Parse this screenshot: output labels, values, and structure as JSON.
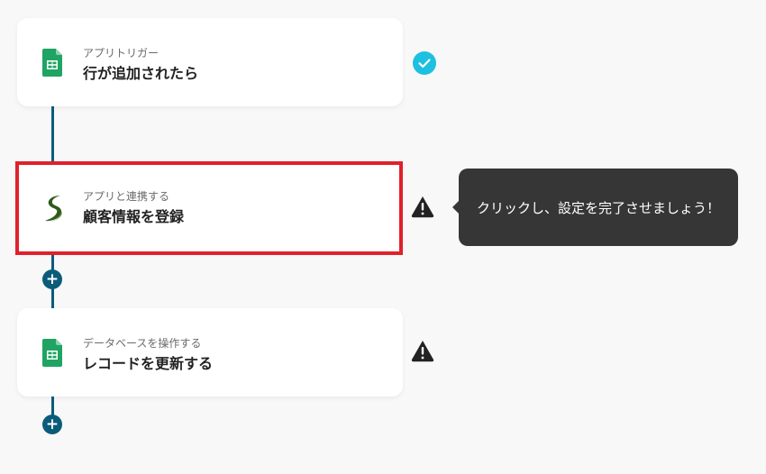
{
  "flow": {
    "steps": [
      {
        "subtitle": "アプリトリガー",
        "title": "行が追加されたら",
        "app_icon": "google-sheets-icon",
        "status": "complete"
      },
      {
        "subtitle": "アプリと連携する",
        "title": "顧客情報を登録",
        "app_icon": "sansan-icon",
        "status": "warning",
        "selected": true
      },
      {
        "subtitle": "データベースを操作する",
        "title": "レコードを更新する",
        "app_icon": "google-sheets-icon",
        "status": "warning"
      }
    ],
    "add_step_label": "+"
  },
  "tooltip": {
    "text": "クリックし、設定を完了させましょう！"
  },
  "colors": {
    "connector": "#0b5c7a",
    "complete": "#1ec0e0",
    "selected_border": "#e0212b",
    "sheets_green": "#1fa463",
    "tooltip_bg": "#363636"
  }
}
